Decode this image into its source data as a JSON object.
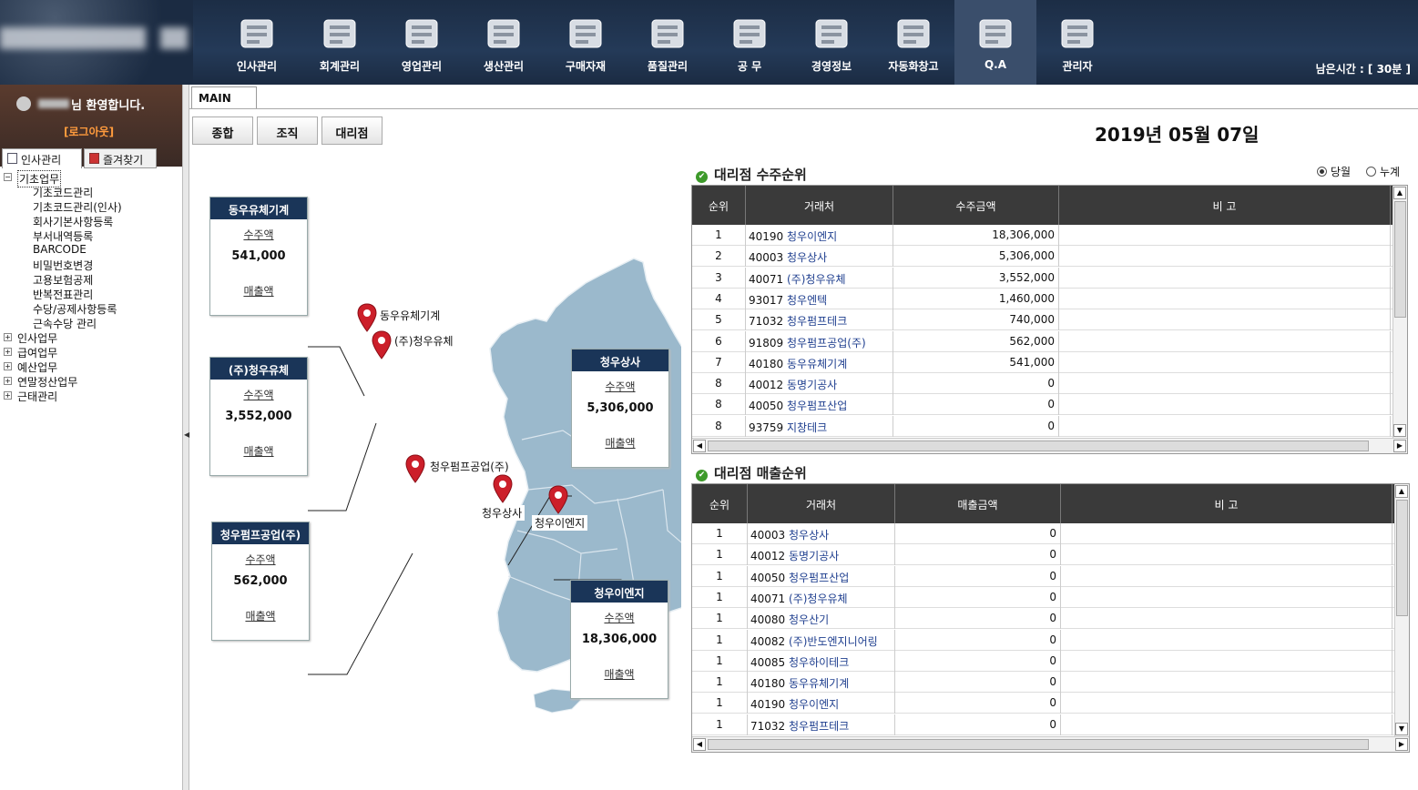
{
  "header": {
    "nav": [
      {
        "label": "인사관리",
        "icon": "id-card-icon"
      },
      {
        "label": "회계관리",
        "icon": "chart-arrow-icon"
      },
      {
        "label": "영업관리",
        "icon": "handshake-icon"
      },
      {
        "label": "생산관리",
        "icon": "box-icon"
      },
      {
        "label": "구매자재",
        "icon": "cart-icon"
      },
      {
        "label": "품질관리",
        "icon": "pie-check-icon"
      },
      {
        "label": "공   무",
        "icon": "tools-icon"
      },
      {
        "label": "경영정보",
        "icon": "checklist-icon"
      },
      {
        "label": "자동화창고",
        "icon": "layers-icon"
      },
      {
        "label": "Q.A",
        "icon": "report-icon"
      },
      {
        "label": "관리자",
        "icon": "admin-person-icon"
      }
    ],
    "remaining_time": "남은시간 : [ 30분 ]"
  },
  "sidebar": {
    "welcome": "님 환영합니다.",
    "logout": "[로그아웃]",
    "tabs": [
      "인사관리",
      "즐겨찾기"
    ],
    "tree": [
      {
        "label": "기초업무",
        "expanded": true,
        "children": [
          "기초코드관리",
          "기초코드관리(인사)",
          "회사기본사항등록",
          "부서내역등록",
          "BARCODE",
          "비밀번호변경",
          "고용보험공제",
          "반복전표관리",
          "수당/공제사항등록",
          "근속수당 관리"
        ]
      },
      {
        "label": "인사업무"
      },
      {
        "label": "급여업무"
      },
      {
        "label": "예산업무"
      },
      {
        "label": "연말정산업무"
      },
      {
        "label": "근태관리"
      }
    ]
  },
  "main": {
    "tab": "MAIN",
    "buttons": [
      "종합",
      "조직",
      "대리점"
    ],
    "date": "2019년 05월 07일",
    "map_cards": [
      {
        "name": "동우유체기계",
        "order_label": "수주액",
        "order_value": "541,000",
        "sales_label": "매출액"
      },
      {
        "name": "(주)청우유체",
        "order_label": "수주액",
        "order_value": "3,552,000",
        "sales_label": "매출액"
      },
      {
        "name": "청우펌프공업(주)",
        "order_label": "수주액",
        "order_value": "562,000",
        "sales_label": "매출액"
      },
      {
        "name": "청우상사",
        "order_label": "수주액",
        "order_value": "5,306,000",
        "sales_label": "매출액"
      },
      {
        "name": "청우이엔지",
        "order_label": "수주액",
        "order_value": "18,306,000",
        "sales_label": "매출액"
      }
    ],
    "pins": [
      "동우유체기계",
      "(주)청우유체",
      "청우펌프공업(주)",
      "청우상사",
      "청우이엔지"
    ]
  },
  "orders": {
    "title": "대리점 수주순위",
    "radio": [
      "당월",
      "누계"
    ],
    "headers": [
      "순위",
      "거래처",
      "수주금액",
      "비   고"
    ],
    "rows": [
      [
        "1",
        "40190",
        "청우이엔지",
        "18,306,000"
      ],
      [
        "2",
        "40003",
        "청우상사",
        "5,306,000"
      ],
      [
        "3",
        "40071",
        "(주)청우유체",
        "3,552,000"
      ],
      [
        "4",
        "93017",
        "청우엔텍",
        "1,460,000"
      ],
      [
        "5",
        "71032",
        "청우펌프테크",
        "740,000"
      ],
      [
        "6",
        "91809",
        "청우펌프공업(주)",
        "562,000"
      ],
      [
        "7",
        "40180",
        "동우유체기계",
        "541,000"
      ],
      [
        "8",
        "40012",
        "동명기공사",
        "0"
      ],
      [
        "8",
        "40050",
        "청우펌프산업",
        "0"
      ],
      [
        "8",
        "93759",
        "지창테크",
        "0"
      ]
    ]
  },
  "sales": {
    "title": "대리점 매출순위",
    "headers": [
      "순위",
      "거래처",
      "매출금액",
      "비   고"
    ],
    "rows": [
      [
        "1",
        "40003",
        "청우상사",
        "0"
      ],
      [
        "1",
        "40012",
        "동명기공사",
        "0"
      ],
      [
        "1",
        "40050",
        "청우펌프산업",
        "0"
      ],
      [
        "1",
        "40071",
        "(주)청우유체",
        "0"
      ],
      [
        "1",
        "40080",
        "청우산기",
        "0"
      ],
      [
        "1",
        "40082",
        "(주)반도엔지니어링",
        "0"
      ],
      [
        "1",
        "40085",
        "청우하이테크",
        "0"
      ],
      [
        "1",
        "40180",
        "동우유체기계",
        "0"
      ],
      [
        "1",
        "40190",
        "청우이엔지",
        "0"
      ],
      [
        "1",
        "71032",
        "청우펌프테크",
        "0"
      ]
    ]
  },
  "colors": {
    "header_bg": "#1f3350",
    "card_header": "#1a3558",
    "grid_header": "#3a3a3a",
    "link": "#1f3f8f",
    "pin": "#cc1f2a",
    "map": "#9bb9cc"
  }
}
